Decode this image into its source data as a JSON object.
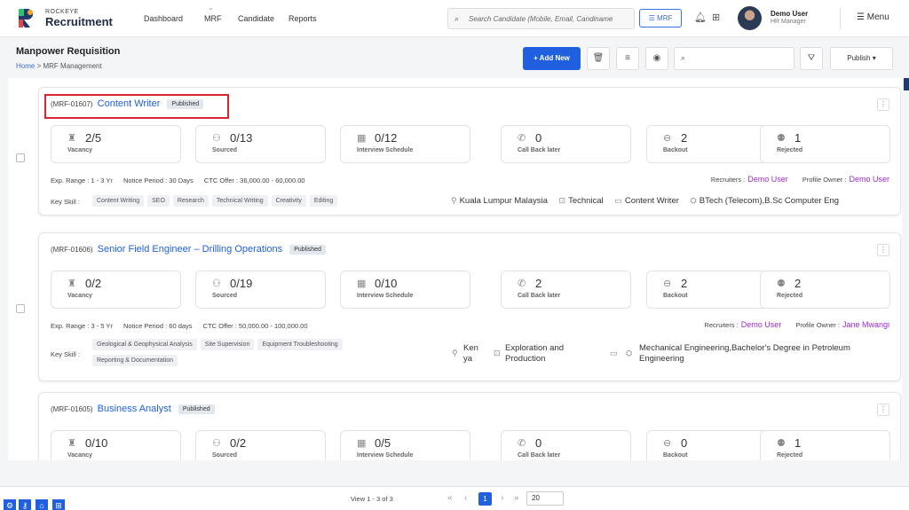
{
  "app": {
    "brand_small": "ROCKEYE",
    "brand_big": "Recruitment"
  },
  "nav": {
    "items": [
      "Dashboard",
      "MRF",
      "Candidate",
      "Reports"
    ],
    "active_chevron": "⌄"
  },
  "search": {
    "placeholder": "Search Candidate (Mobile, Email, Candiname"
  },
  "header": {
    "mrf_filter": "MRF",
    "user_name": "Demo User",
    "user_role": "HR Manager",
    "menu_label": "Menu"
  },
  "page": {
    "title": "Manpower Requisition",
    "breadcrumb_home": "Home",
    "breadcrumb_sep": ">",
    "breadcrumb_current": "MRF Management"
  },
  "toolbar": {
    "add_label": "+ Add New",
    "publish_label": "Publish ▾"
  },
  "labels": {
    "vacancy": "Vacancy",
    "sourced": "Sourced",
    "interview": "Interview Schedule",
    "callback": "Call Back later",
    "backout": "Backout",
    "rejected": "Rejected",
    "recruiters": "Recruiters :",
    "profile_owner": "Profile Owner :",
    "key_skill": "Key Skill :"
  },
  "cards": [
    {
      "code": "(MRF-01607)",
      "title": "Content Writer",
      "status": "Published",
      "stats": {
        "vacancy": "2/5",
        "sourced": "0/13",
        "interview": "0/12",
        "callback": "0",
        "backout": "2",
        "rejected": "1"
      },
      "exp": "Exp. Range : 1 - 3 Yr",
      "notice": "Notice Period : 30 Days",
      "ctc": "CTC Offer : 36,000.00 - 60,000.00",
      "recruiter": "Demo User",
      "owner": "Demo User",
      "skills": [
        "Content Writing",
        "SEO",
        "Research",
        "Technical Writing",
        "Creativity",
        "Editing"
      ],
      "location": "Kuala Lumpur Malaysia",
      "department": "Technical",
      "designation": "Content Writer",
      "education": "BTech (Telecom),B.Sc Computer Eng"
    },
    {
      "code": "(MRF-01606)",
      "title": "Senior Field Engineer – Drilling Operations",
      "status": "Published",
      "stats": {
        "vacancy": "0/2",
        "sourced": "0/19",
        "interview": "0/10",
        "callback": "2",
        "backout": "2",
        "rejected": "2"
      },
      "exp": "Exp. Range : 3 - 5 Yr",
      "notice": "Notice Period : 60 days",
      "ctc": "CTC Offer : 50,000.00 - 100,000.00",
      "recruiter": "Demo User",
      "owner": "Jane Mwangi",
      "skills": [
        "Geological & Geophysical Analysis",
        "Site Supervision",
        "Equipment Troubleshooting",
        "Reporting & Documentation"
      ],
      "location_line1": "Ken",
      "location_line2": "ya",
      "department_line1": "Exploration and",
      "department_line2": "Production",
      "education_line1": "Mechanical Engineering,Bachelor's Degree in Petroleum",
      "education_line2": "Engineering"
    },
    {
      "code": "(MRF-01605)",
      "title": "Business Analyst",
      "status": "Published",
      "stats": {
        "vacancy": "0/10",
        "sourced": "0/2",
        "interview": "0/5",
        "callback": "0",
        "backout": "0",
        "rejected": "1"
      }
    }
  ],
  "pagination": {
    "view_info": "View 1 - 3 of 3",
    "current_page": "1",
    "page_size": "20"
  },
  "colors": {
    "primary": "#1f5fe0",
    "link_purple": "#9b2bcf",
    "highlight": "#d9262f"
  }
}
